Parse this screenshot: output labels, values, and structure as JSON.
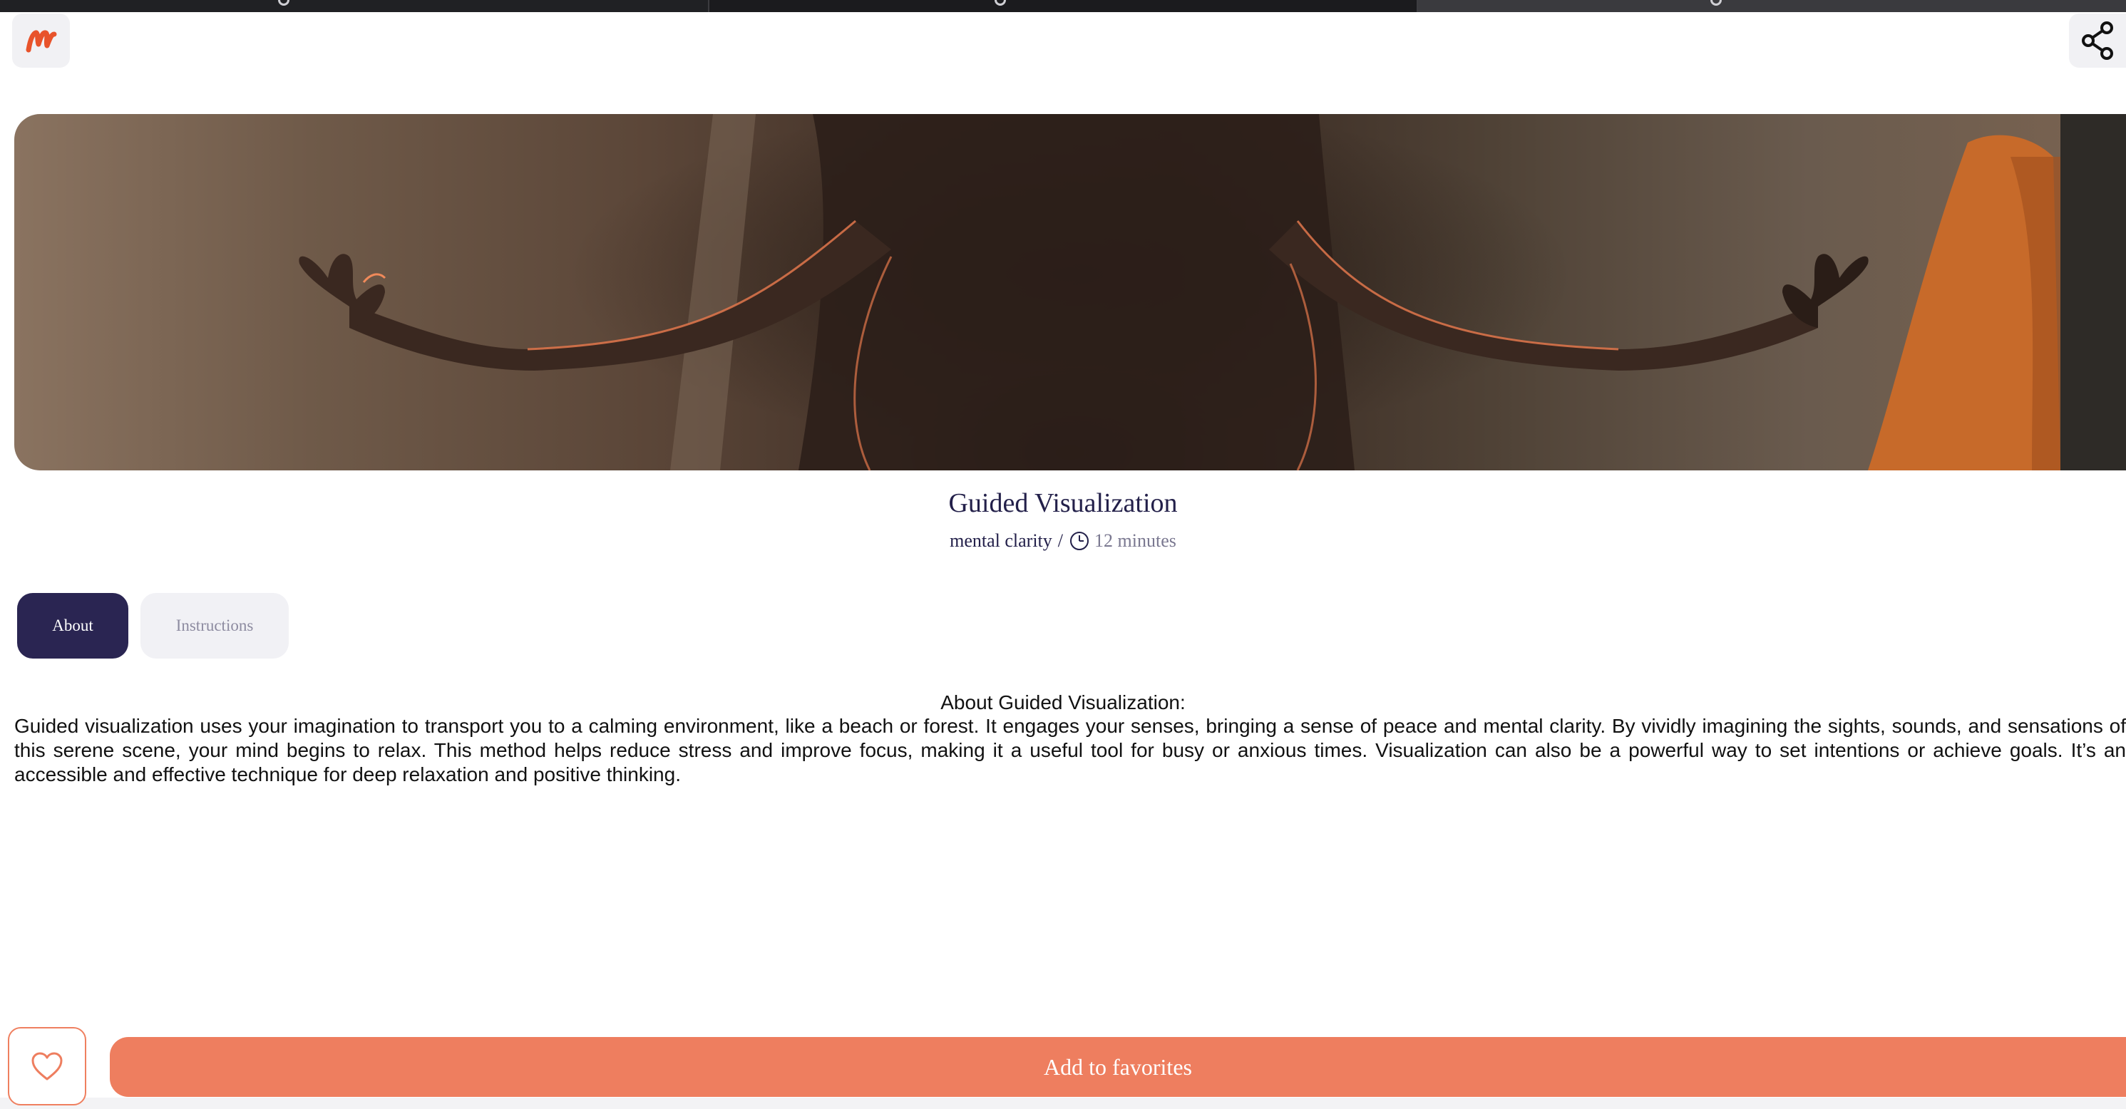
{
  "header": {
    "logo_icon": "m-logo-icon",
    "logo_color": "#e8532b",
    "share_icon": "share-icon"
  },
  "hero": {
    "image_kind": "meditation-photo"
  },
  "session": {
    "title": "Guided Visualization",
    "category": "mental clarity",
    "separator": "/",
    "duration": "12 minutes",
    "duration_icon": "clock-icon"
  },
  "tabs": [
    {
      "label": "About",
      "active": true
    },
    {
      "label": "Instructions",
      "active": false
    }
  ],
  "about": {
    "heading": "About Guided Visualization:",
    "body": "Guided visualization uses your imagination to transport you to a calming environment, like a beach or forest. It engages your senses, bringing a sense of peace and mental clarity. By vividly imagining the sights, sounds, and sensations of this serene scene, your mind begins to relax. This method helps reduce stress and improve focus, making it a useful tool for busy or anxious times. Visualization can also be a powerful way to set intentions or achieve goals. It’s an accessible and effective technique for deep relaxation and positive thinking."
  },
  "footer": {
    "heart_icon": "heart-icon",
    "add_favorites_label": "Add to favorites"
  },
  "colors": {
    "primary_dark": "#2a2552",
    "accent_orange": "#ee7e5f",
    "tab_inactive_bg": "#f1f1f5",
    "muted_text": "#7a7890"
  }
}
